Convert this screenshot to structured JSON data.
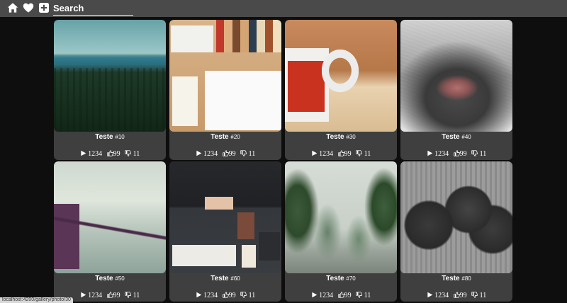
{
  "nav": {
    "home_icon": "home-icon",
    "favorites_icon": "heart-icon",
    "add_icon": "plus-square-icon",
    "search_placeholder": "Search"
  },
  "gallery": {
    "cards": [
      {
        "title": "Teste",
        "number": "#10",
        "views": "1234",
        "likes": "99",
        "dislikes": "11"
      },
      {
        "title": "Teste",
        "number": "#20",
        "views": "1234",
        "likes": "99",
        "dislikes": "11"
      },
      {
        "title": "Teste",
        "number": "#30",
        "views": "1234",
        "likes": "99",
        "dislikes": "11"
      },
      {
        "title": "Teste",
        "number": "#40",
        "views": "1234",
        "likes": "99",
        "dislikes": "11"
      },
      {
        "title": "Teste",
        "number": "#50",
        "views": "1234",
        "likes": "99",
        "dislikes": "11"
      },
      {
        "title": "Teste",
        "number": "#60",
        "views": "1234",
        "likes": "99",
        "dislikes": "11"
      },
      {
        "title": "Teste",
        "number": "#70",
        "views": "1234",
        "likes": "99",
        "dislikes": "11"
      },
      {
        "title": "Teste",
        "number": "#80",
        "views": "1234",
        "likes": "99",
        "dislikes": "11"
      }
    ]
  },
  "status_bar": {
    "url": "localhost:4200/gallery/photo/30"
  },
  "colors": {
    "topbar": "#4a4a4a",
    "background": "#0e0e0e",
    "card": "#3f3f3f"
  }
}
